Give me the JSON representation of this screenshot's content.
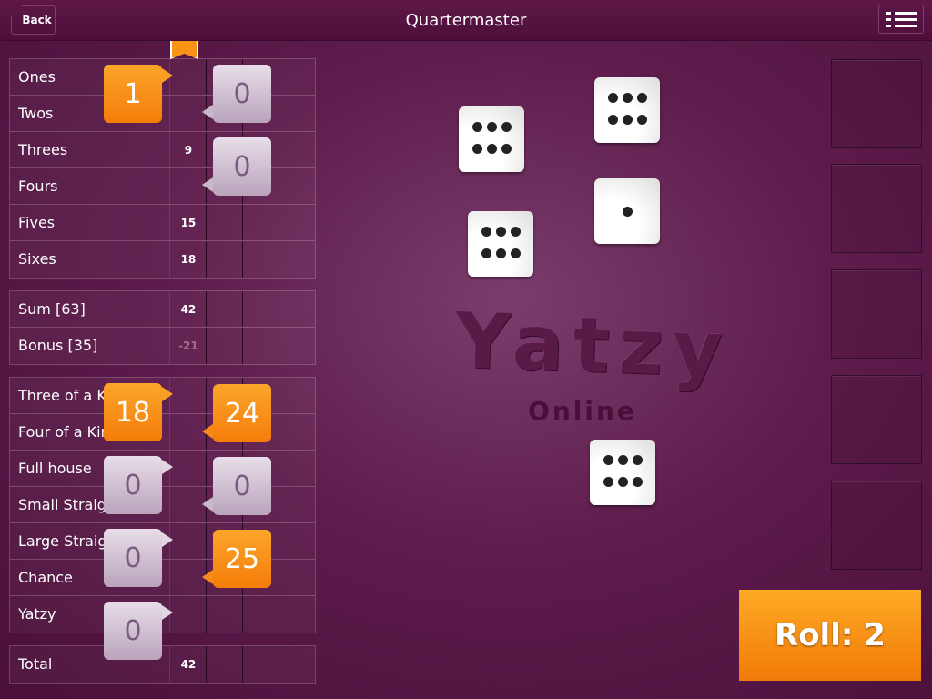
{
  "header": {
    "back_label": "Back",
    "title": "Quartermaster",
    "menu_icon": "list-icon"
  },
  "upper": [
    {
      "label": "Ones",
      "p1": ""
    },
    {
      "label": "Twos",
      "p1": ""
    },
    {
      "label": "Threes",
      "p1": "9"
    },
    {
      "label": "Fours",
      "p1": ""
    },
    {
      "label": "Fives",
      "p1": "15"
    },
    {
      "label": "Sixes",
      "p1": "18"
    }
  ],
  "bonus": [
    {
      "label": "Sum [63]",
      "p1": "42"
    },
    {
      "label": "Bonus [35]",
      "p1": "-21"
    }
  ],
  "lower": [
    {
      "label": "Three of a Kind",
      "p1": ""
    },
    {
      "label": "Four of a Kind",
      "p1": ""
    },
    {
      "label": "Full house",
      "p1": ""
    },
    {
      "label": "Small Straight",
      "p1": ""
    },
    {
      "label": "Large Straight",
      "p1": ""
    },
    {
      "label": "Chance",
      "p1": ""
    },
    {
      "label": "Yatzy",
      "p1": ""
    }
  ],
  "total": {
    "label": "Total",
    "p1": "42"
  },
  "suggestions": [
    "1",
    "0",
    "0",
    "18",
    "24",
    "0",
    "0",
    "0",
    "25",
    "0"
  ],
  "dice": [
    6,
    6,
    6,
    1,
    6
  ],
  "logo": {
    "line1": "Yatzy",
    "line2": "Online"
  },
  "roll_label": "Roll: 2",
  "colors": {
    "accent": "#f7901a",
    "background": "#5e1c4c"
  }
}
